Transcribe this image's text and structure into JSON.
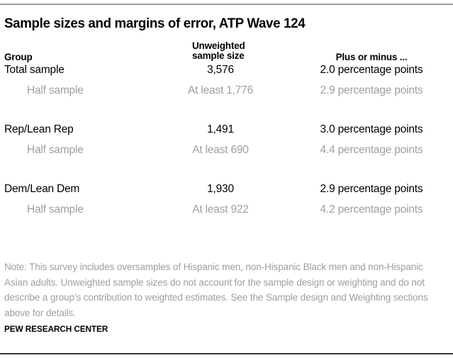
{
  "chart_data": {
    "type": "table",
    "title": "Sample sizes and margins of error, ATP Wave 124",
    "columns": [
      "Group",
      "Unweighted sample size",
      "Plus or minus ..."
    ],
    "rows": [
      {
        "group": "Total sample",
        "sample_size": "3,576",
        "moe": "2.0 percentage points",
        "style": "primary"
      },
      {
        "group": "Half sample",
        "sample_size": "At least 1,776",
        "moe": "2.9 percentage points",
        "style": "sub"
      },
      {
        "group": "Rep/Lean Rep",
        "sample_size": "1,491",
        "moe": "3.0 percentage points",
        "style": "primary"
      },
      {
        "group": "Half sample",
        "sample_size": "At least 690",
        "moe": "4.4 percentage points",
        "style": "sub"
      },
      {
        "group": "Dem/Lean Dem",
        "sample_size": "1,930",
        "moe": "2.9 percentage points",
        "style": "primary"
      },
      {
        "group": "Half sample",
        "sample_size": "At least 922",
        "moe": "4.2 percentage points",
        "style": "sub"
      }
    ],
    "note": "Note: This survey includes oversamples of Hispanic men, non-Hispanic Black men and non-Hispanic Asian adults. Unweighted sample sizes do not account for the sample design or weighting and do not describe a group’s contribution to weighted estimates. See the Sample design and Weighting sections above for details.",
    "source": "PEW RESEARCH CENTER"
  },
  "title": "Sample sizes and margins of error, ATP Wave 124",
  "header": {
    "group": "Group",
    "size_line1": "Unweighted",
    "size_line2": "sample size",
    "moe": "Plus or minus ..."
  },
  "rows": {
    "r0": {
      "group": "Total sample",
      "size": "3,576",
      "moe": "2.0 percentage points"
    },
    "r1": {
      "group": "Half sample",
      "size": "At least 1,776",
      "moe": "2.9 percentage points"
    },
    "r2": {
      "group": "Rep/Lean Rep",
      "size": "1,491",
      "moe": "3.0 percentage points"
    },
    "r3": {
      "group": "Half sample",
      "size": "At least 690",
      "moe": "4.4 percentage points"
    },
    "r4": {
      "group": "Dem/Lean Dem",
      "size": "1,930",
      "moe": "2.9 percentage points"
    },
    "r5": {
      "group": "Half sample",
      "size": "At least 922",
      "moe": "4.2 percentage points"
    }
  },
  "note": "Note: This survey includes oversamples of Hispanic men, non-Hispanic Black men and non-Hispanic Asian adults. Unweighted sample sizes do not account for the sample design or weighting and do not describe a group’s contribution to weighted estimates. See the Sample design and Weighting sections above for details.",
  "source": "PEW RESEARCH CENTER",
  "colors": {
    "text": "#000000",
    "muted": "#9d9fa2",
    "top_rule": "#9c9c9c",
    "bottom_rule": "#3b3b3b"
  }
}
